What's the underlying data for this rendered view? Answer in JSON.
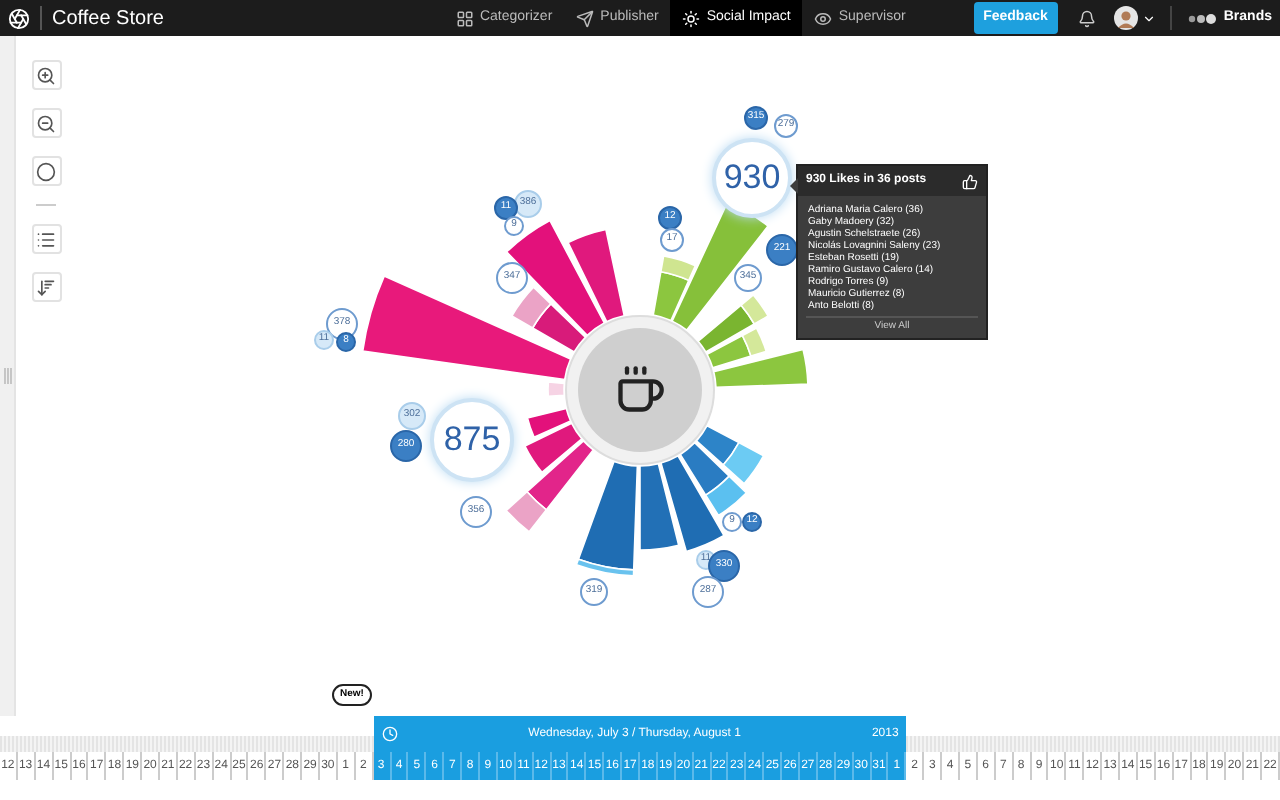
{
  "app": {
    "title": "Coffee Store"
  },
  "nav_tabs": [
    {
      "label": "Categorizer",
      "selected": false,
      "kind": "grid"
    },
    {
      "label": "Publisher",
      "selected": false,
      "kind": "send"
    },
    {
      "label": "Social Impact",
      "selected": true,
      "kind": "burst"
    },
    {
      "label": "Supervisor",
      "selected": false,
      "kind": "eye"
    }
  ],
  "header": {
    "feedback": "Feedback",
    "account": "Brands"
  },
  "bubbles": [
    {
      "label": "315",
      "kind": "filled"
    },
    {
      "label": "279",
      "kind": "outline"
    },
    {
      "label": "930",
      "kind": "big"
    },
    {
      "label": "386",
      "kind": "light"
    },
    {
      "label": "11",
      "kind": "filled"
    },
    {
      "label": "9",
      "kind": "outline"
    },
    {
      "label": "12",
      "kind": "filled"
    },
    {
      "label": "17",
      "kind": "outline"
    },
    {
      "label": "347",
      "kind": "outline"
    },
    {
      "label": "221",
      "kind": "filled"
    },
    {
      "label": "345",
      "kind": "outline"
    },
    {
      "label": "378",
      "kind": "outline"
    },
    {
      "label": "11",
      "kind": "light"
    },
    {
      "label": "8",
      "kind": "filled"
    },
    {
      "label": "875",
      "kind": "big"
    },
    {
      "label": "302",
      "kind": "light"
    },
    {
      "label": "280",
      "kind": "filled"
    },
    {
      "label": "356",
      "kind": "outline"
    },
    {
      "label": "9",
      "kind": "outline"
    },
    {
      "label": "12",
      "kind": "filled"
    },
    {
      "label": "11",
      "kind": "light"
    },
    {
      "label": "330",
      "kind": "filled"
    },
    {
      "label": "287",
      "kind": "outline"
    },
    {
      "label": "319",
      "kind": "outline"
    }
  ],
  "tooltip": {
    "title": "930 Likes in 36 posts",
    "items": [
      "Adriana Maria Calero (36)",
      "Gaby Madoery (32)",
      "Agustin Schelstraete (26)",
      "Nicolás Lovagnini Saleny (23)",
      "Esteban Rosetti (19)",
      "Ramiro Gustavo Calero (14)",
      "Rodrigo Torres (9)",
      "Mauricio Gutierrez (8)",
      "Anto Belotti (8)"
    ],
    "link": "View All"
  },
  "timeline": {
    "badge": "New!",
    "range": "Wednesday, July 3 / Thursday, August 1",
    "year": "2013",
    "days": [
      {
        "label": "12",
        "selected": false
      },
      {
        "label": "13",
        "selected": false
      },
      {
        "label": "14",
        "selected": false
      },
      {
        "label": "15",
        "selected": false
      },
      {
        "label": "16",
        "selected": false
      },
      {
        "label": "17",
        "selected": false
      },
      {
        "label": "18",
        "selected": false
      },
      {
        "label": "19",
        "selected": false
      },
      {
        "label": "20",
        "selected": false
      },
      {
        "label": "21",
        "selected": false
      },
      {
        "label": "22",
        "selected": false
      },
      {
        "label": "23",
        "selected": false
      },
      {
        "label": "24",
        "selected": false
      },
      {
        "label": "25",
        "selected": false
      },
      {
        "label": "26",
        "selected": false
      },
      {
        "label": "27",
        "selected": false
      },
      {
        "label": "28",
        "selected": false
      },
      {
        "label": "29",
        "selected": false
      },
      {
        "label": "30",
        "selected": false
      },
      {
        "label": "1",
        "selected": false
      },
      {
        "label": "2",
        "selected": false
      },
      {
        "label": "3",
        "selected": true
      },
      {
        "label": "4",
        "selected": true
      },
      {
        "label": "5",
        "selected": true
      },
      {
        "label": "6",
        "selected": true
      },
      {
        "label": "7",
        "selected": true
      },
      {
        "label": "8",
        "selected": true
      },
      {
        "label": "9",
        "selected": true
      },
      {
        "label": "10",
        "selected": true
      },
      {
        "label": "11",
        "selected": true
      },
      {
        "label": "12",
        "selected": true
      },
      {
        "label": "13",
        "selected": true
      },
      {
        "label": "14",
        "selected": true
      },
      {
        "label": "15",
        "selected": true
      },
      {
        "label": "16",
        "selected": true
      },
      {
        "label": "17",
        "selected": true
      },
      {
        "label": "18",
        "selected": true
      },
      {
        "label": "19",
        "selected": true
      },
      {
        "label": "20",
        "selected": true
      },
      {
        "label": "21",
        "selected": true
      },
      {
        "label": "22",
        "selected": true
      },
      {
        "label": "23",
        "selected": true
      },
      {
        "label": "24",
        "selected": true
      },
      {
        "label": "25",
        "selected": true
      },
      {
        "label": "26",
        "selected": true
      },
      {
        "label": "27",
        "selected": true
      },
      {
        "label": "28",
        "selected": true
      },
      {
        "label": "29",
        "selected": true
      },
      {
        "label": "30",
        "selected": true
      },
      {
        "label": "31",
        "selected": true
      },
      {
        "label": "1",
        "selected": true
      },
      {
        "label": "2",
        "selected": false
      },
      {
        "label": "3",
        "selected": false
      },
      {
        "label": "4",
        "selected": false
      },
      {
        "label": "5",
        "selected": false
      },
      {
        "label": "6",
        "selected": false
      },
      {
        "label": "7",
        "selected": false
      },
      {
        "label": "8",
        "selected": false
      },
      {
        "label": "9",
        "selected": false
      },
      {
        "label": "10",
        "selected": false
      },
      {
        "label": "11",
        "selected": false
      },
      {
        "label": "12",
        "selected": false
      },
      {
        "label": "13",
        "selected": false
      },
      {
        "label": "14",
        "selected": false
      },
      {
        "label": "15",
        "selected": false
      },
      {
        "label": "16",
        "selected": false
      },
      {
        "label": "17",
        "selected": false
      },
      {
        "label": "18",
        "selected": false
      },
      {
        "label": "19",
        "selected": false
      },
      {
        "label": "20",
        "selected": false
      },
      {
        "label": "21",
        "selected": false
      },
      {
        "label": "22",
        "selected": false
      }
    ]
  }
}
